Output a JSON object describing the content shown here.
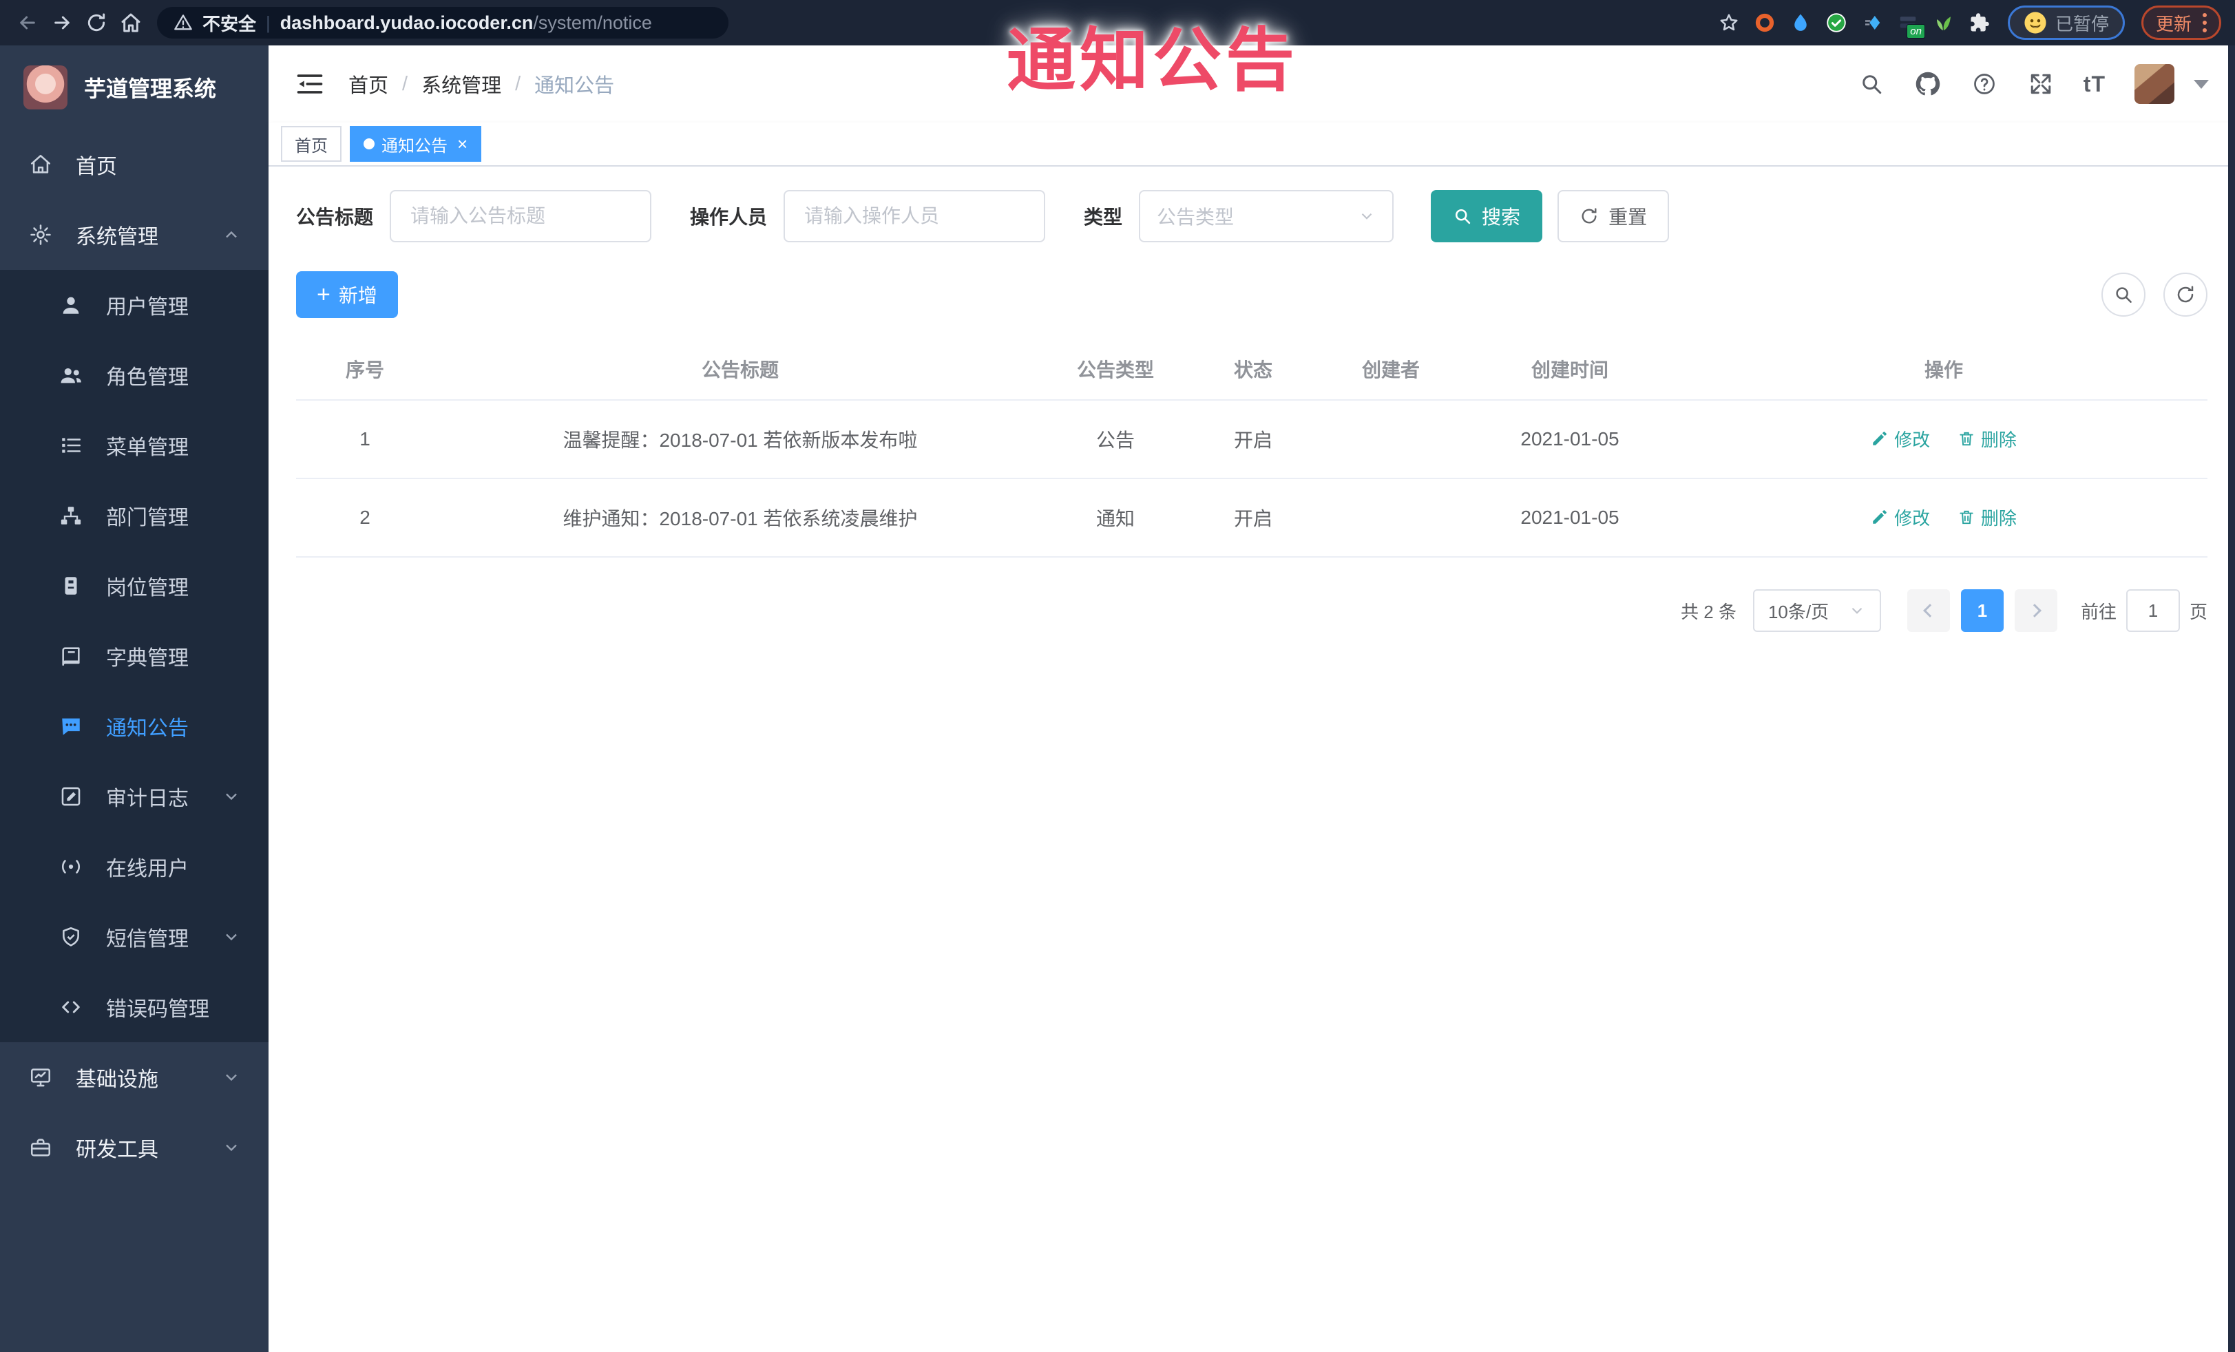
{
  "browser": {
    "security_label": "不安全",
    "url_host": "dashboard.yudao.iocoder.cn",
    "url_path": "/system/notice",
    "extension_badge": "on",
    "profile_status": "已暂停",
    "update_label": "更新"
  },
  "watermark": {
    "text": "通知公告",
    "color": "#ee4a67"
  },
  "sidebar": {
    "app_title": "芋道管理系统",
    "items": [
      {
        "label": "首页"
      },
      {
        "label": "系统管理"
      },
      {
        "label": "用户管理"
      },
      {
        "label": "角色管理"
      },
      {
        "label": "菜单管理"
      },
      {
        "label": "部门管理"
      },
      {
        "label": "岗位管理"
      },
      {
        "label": "字典管理"
      },
      {
        "label": "通知公告"
      },
      {
        "label": "审计日志"
      },
      {
        "label": "在线用户"
      },
      {
        "label": "短信管理"
      },
      {
        "label": "错误码管理"
      },
      {
        "label": "基础设施"
      },
      {
        "label": "研发工具"
      }
    ]
  },
  "header": {
    "breadcrumb": [
      "首页",
      "系统管理",
      "通知公告"
    ],
    "font_size_icon_text": "tT"
  },
  "tags": [
    {
      "label": "首页"
    },
    {
      "label": "通知公告"
    }
  ],
  "filters": {
    "title_label": "公告标题",
    "title_placeholder": "请输入公告标题",
    "operator_label": "操作人员",
    "operator_placeholder": "请输入操作人员",
    "type_label": "类型",
    "type_placeholder": "公告类型",
    "search_label": "搜索",
    "reset_label": "重置"
  },
  "toolbar": {
    "add_label": "新增"
  },
  "table": {
    "headers": [
      "序号",
      "公告标题",
      "公告类型",
      "状态",
      "创建者",
      "创建时间",
      "操作"
    ],
    "rows": [
      {
        "index": "1",
        "title": "温馨提醒：2018-07-01 若依新版本发布啦",
        "type": "公告",
        "status": "开启",
        "creator": "",
        "created": "2021-01-05"
      },
      {
        "index": "2",
        "title": "维护通知：2018-07-01 若依系统凌晨维护",
        "type": "通知",
        "status": "开启",
        "creator": "",
        "created": "2021-01-05"
      }
    ],
    "edit_label": "修改",
    "delete_label": "删除"
  },
  "pagination": {
    "total": "共 2 条",
    "page_size": "10条/页",
    "current_page": "1",
    "goto_label": "前往",
    "goto_value": "1",
    "page_unit": "页"
  },
  "colors": {
    "primary": "#409eff",
    "action_teal": "#2aa4a0",
    "watermark_red": "#ee4a67",
    "sidebar_bg": "#2d3a4f",
    "submenu_bg": "#1e2a3c",
    "browser_bar_bg": "#1c2536"
  }
}
